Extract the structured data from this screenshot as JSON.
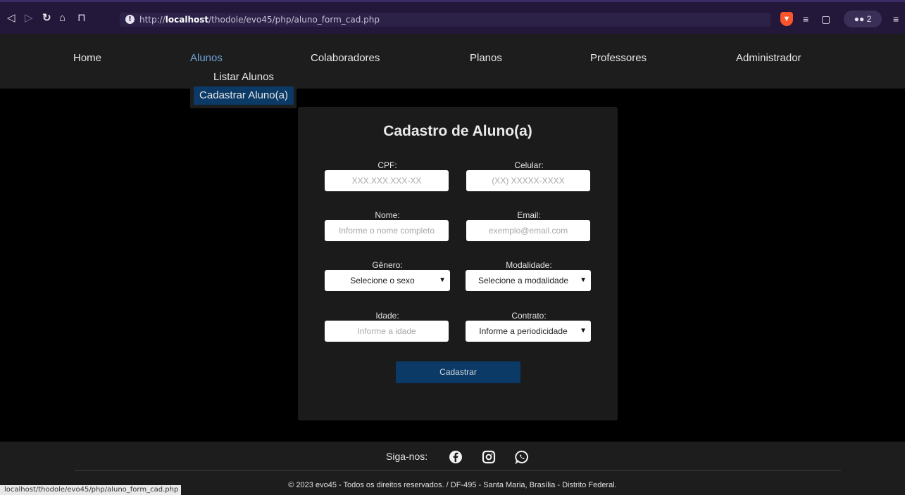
{
  "browser": {
    "url_prefix": "http://",
    "url_host": "localhost",
    "url_path": "/thodole/evo45/php/aluno_form_cad.php",
    "profile_count": "2"
  },
  "nav": {
    "links": [
      "Home",
      "Alunos",
      "Colaboradores",
      "Planos",
      "Professores",
      "Administrador"
    ],
    "active": "Alunos",
    "dropdown": [
      "Listar Alunos",
      "Cadastrar Aluno(a)"
    ]
  },
  "form": {
    "title": "Cadastro de Aluno(a)",
    "cpf_label": "CPF:",
    "cpf_placeholder": "XXX.XXX.XXX-XX",
    "celular_label": "Celular:",
    "celular_placeholder": "(XX) XXXXX-XXXX",
    "nome_label": "Nome:",
    "nome_placeholder": "Informe o nome completo",
    "email_label": "Email:",
    "email_placeholder": "exemplo@email.com",
    "genero_label": "Gênero:",
    "genero_selected": "Selecione o sexo",
    "modalidade_label": "Modalidade:",
    "modalidade_selected": "Selecione a modalidade",
    "idade_label": "Idade:",
    "idade_placeholder": "Informe a idade",
    "contrato_label": "Contrato:",
    "contrato_selected": "Informe a periodicidade",
    "submit_label": "Cadastrar"
  },
  "footer": {
    "follow_label": "Siga-nos:",
    "social_icons": [
      "facebook-icon",
      "instagram-icon",
      "whatsapp-icon"
    ],
    "copyright": "© 2023 evo45 - Todos os direitos reservados.  /  DF-495 - Santa Maria, Brasília - Distrito Federal."
  },
  "status_bar": {
    "url": "localhost/thodole/evo45/php/aluno_form_cad.php"
  },
  "colors": {
    "page_bg": "#000000",
    "nav_bg": "#1d1d1d",
    "card_bg": "#1b1b1b",
    "accent": "#0b3a66",
    "active_link": "#6fa3d8"
  }
}
